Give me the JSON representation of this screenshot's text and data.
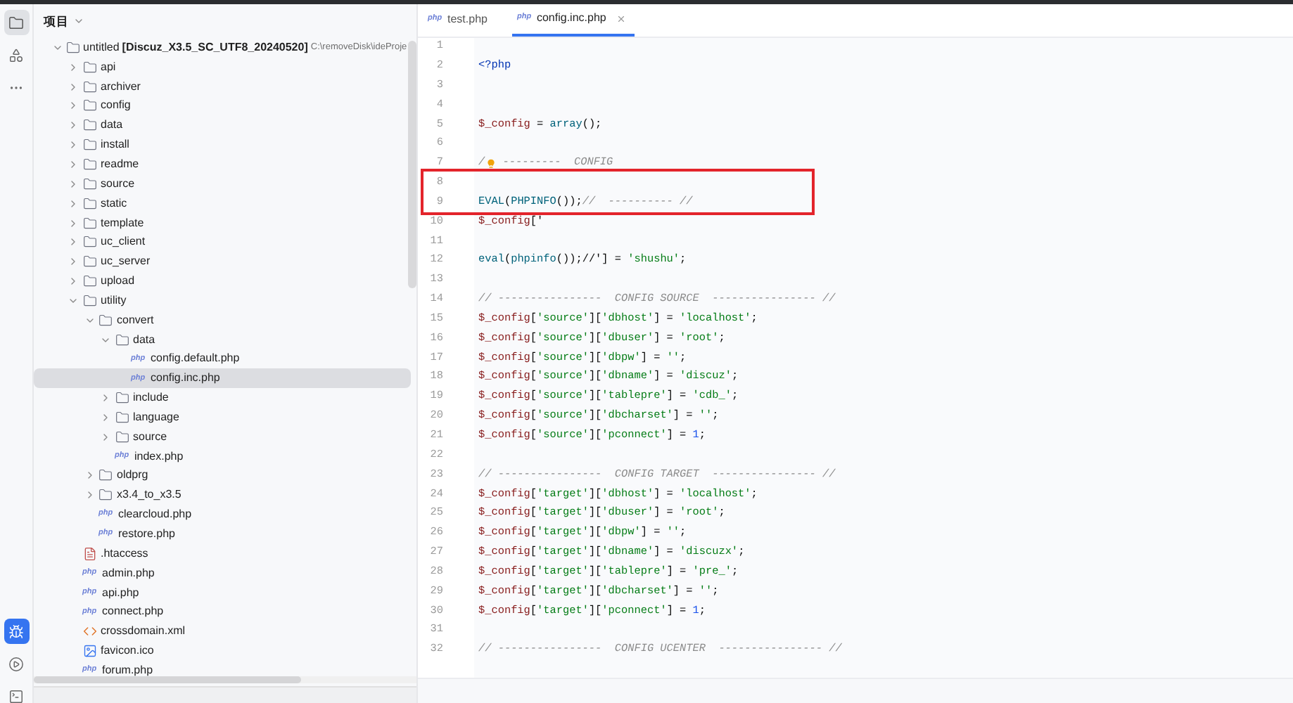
{
  "sidebar_strip": {
    "top": [
      {
        "kind": "folder",
        "selected": true
      },
      {
        "kind": "structure",
        "selected": false
      },
      {
        "kind": "more",
        "selected": false
      }
    ],
    "bottom": [
      {
        "kind": "bug",
        "selected": true
      },
      {
        "kind": "play",
        "selected": false
      },
      {
        "kind": "terminal",
        "selected": false
      }
    ]
  },
  "project": {
    "title": "项目",
    "root": {
      "name": "untitled",
      "module": "[Discuz_X3.5_SC_UTF8_20240520]",
      "path": "C:\\removeDisk\\ideProje",
      "expanded": true
    },
    "items": [
      {
        "label": "api",
        "kind": "folder",
        "expanded": false,
        "selected": false
      },
      {
        "label": "archiver",
        "kind": "folder",
        "expanded": false,
        "selected": false
      },
      {
        "label": "config",
        "kind": "folder",
        "expanded": false,
        "selected": false
      },
      {
        "label": "data",
        "kind": "folder",
        "expanded": false,
        "selected": false
      },
      {
        "label": "install",
        "kind": "folder",
        "expanded": false,
        "selected": false
      },
      {
        "label": "readme",
        "kind": "folder",
        "expanded": false,
        "selected": false
      },
      {
        "label": "source",
        "kind": "folder",
        "expanded": false,
        "selected": false
      },
      {
        "label": "static",
        "kind": "folder",
        "expanded": false,
        "selected": false
      },
      {
        "label": "template",
        "kind": "folder",
        "expanded": false,
        "selected": false
      },
      {
        "label": "uc_client",
        "kind": "folder",
        "expanded": false,
        "selected": false
      },
      {
        "label": "uc_server",
        "kind": "folder",
        "expanded": false,
        "selected": false
      },
      {
        "label": "upload",
        "kind": "folder",
        "expanded": false,
        "selected": false
      },
      {
        "label": "utility",
        "kind": "folder",
        "expanded": true,
        "selected": false,
        "children": [
          {
            "label": "convert",
            "kind": "folder",
            "expanded": true,
            "selected": false,
            "children": [
              {
                "label": "data",
                "kind": "folder",
                "expanded": true,
                "selected": false,
                "children": [
                  {
                    "label": "config.default.php",
                    "kind": "php",
                    "icon_text": "php",
                    "selected": false
                  },
                  {
                    "label": "config.inc.php",
                    "kind": "php",
                    "icon_text": "php",
                    "selected": true
                  }
                ]
              },
              {
                "label": "include",
                "kind": "folder",
                "expanded": false,
                "selected": false
              },
              {
                "label": "language",
                "kind": "folder",
                "expanded": false,
                "selected": false
              },
              {
                "label": "source",
                "kind": "folder",
                "expanded": false,
                "selected": false
              },
              {
                "label": "index.php",
                "kind": "php",
                "icon_text": "php",
                "selected": false
              }
            ]
          },
          {
            "label": "oldprg",
            "kind": "folder",
            "expanded": false,
            "selected": false
          },
          {
            "label": "x3.4_to_x3.5",
            "kind": "folder",
            "expanded": false,
            "selected": false
          },
          {
            "label": "clearcloud.php",
            "kind": "php",
            "icon_text": "php",
            "selected": false
          },
          {
            "label": "restore.php",
            "kind": "php",
            "icon_text": "php",
            "selected": false
          }
        ]
      },
      {
        "label": ".htaccess",
        "kind": "text",
        "selected": false
      },
      {
        "label": "admin.php",
        "kind": "php",
        "icon_text": "php",
        "selected": false
      },
      {
        "label": "api.php",
        "kind": "php",
        "icon_text": "php",
        "selected": false
      },
      {
        "label": "connect.php",
        "kind": "php",
        "icon_text": "php",
        "selected": false
      },
      {
        "label": "crossdomain.xml",
        "kind": "xml",
        "selected": false
      },
      {
        "label": "favicon.ico",
        "kind": "image",
        "selected": false
      },
      {
        "label": "forum.php",
        "kind": "php",
        "icon_text": "php",
        "selected": false
      }
    ]
  },
  "editor": {
    "tabs": [
      {
        "label": "test.php",
        "icon_text": "php",
        "selected": false,
        "closable": false
      },
      {
        "label": "config.inc.php",
        "icon_text": "php",
        "selected": true,
        "closable": true
      }
    ],
    "lines": [
      {
        "number": "1"
      },
      {
        "number": "2",
        "tokens": [
          {
            "kind": "kw",
            "text": "<?php"
          }
        ]
      },
      {
        "number": "3"
      },
      {
        "number": "4"
      },
      {
        "number": "5",
        "tokens": [
          {
            "kind": "var",
            "text": "$_config"
          },
          {
            "kind": "plain",
            "text": " = "
          },
          {
            "kind": "fn",
            "text": "array"
          },
          {
            "kind": "plain",
            "text": "();"
          }
        ]
      },
      {
        "number": "6"
      },
      {
        "number": "7",
        "tokens": [
          {
            "kind": "comment",
            "text": "/"
          },
          {
            "kind": "bulb"
          },
          {
            "kind": "comment",
            "text": " ---------  CONFIG"
          }
        ]
      },
      {
        "number": "8",
        "boxed": true
      },
      {
        "number": "9",
        "boxed": true,
        "tokens": [
          {
            "kind": "fn",
            "text": "EVAL"
          },
          {
            "kind": "plain",
            "text": "("
          },
          {
            "kind": "fn",
            "text": "PHPINFO"
          },
          {
            "kind": "plain",
            "text": "());"
          },
          {
            "kind": "comment",
            "text": "//  ---------- //"
          }
        ]
      },
      {
        "number": "10",
        "tokens": [
          {
            "kind": "var",
            "text": "$_config"
          },
          {
            "kind": "plain",
            "text": "['"
          }
        ]
      },
      {
        "number": "11"
      },
      {
        "number": "12",
        "tokens": [
          {
            "kind": "fn",
            "text": "eval"
          },
          {
            "kind": "plain",
            "text": "("
          },
          {
            "kind": "fn",
            "text": "phpinfo"
          },
          {
            "kind": "plain",
            "text": "());//'] = "
          },
          {
            "kind": "str",
            "text": "'shushu'"
          },
          {
            "kind": "plain",
            "text": ";"
          }
        ]
      },
      {
        "number": "13"
      },
      {
        "number": "14",
        "tokens": [
          {
            "kind": "comment",
            "text": "// ----------------  CONFIG SOURCE  ---------------- //"
          }
        ]
      },
      {
        "number": "15",
        "tokens": [
          {
            "kind": "var",
            "text": "$_config"
          },
          {
            "kind": "plain",
            "text": "["
          },
          {
            "kind": "str",
            "text": "'source'"
          },
          {
            "kind": "plain",
            "text": "]["
          },
          {
            "kind": "str",
            "text": "'dbhost'"
          },
          {
            "kind": "plain",
            "text": "] = "
          },
          {
            "kind": "str",
            "text": "'localhost'"
          },
          {
            "kind": "plain",
            "text": ";"
          }
        ]
      },
      {
        "number": "16",
        "tokens": [
          {
            "kind": "var",
            "text": "$_config"
          },
          {
            "kind": "plain",
            "text": "["
          },
          {
            "kind": "str",
            "text": "'source'"
          },
          {
            "kind": "plain",
            "text": "]["
          },
          {
            "kind": "str",
            "text": "'dbuser'"
          },
          {
            "kind": "plain",
            "text": "] = "
          },
          {
            "kind": "str",
            "text": "'root'"
          },
          {
            "kind": "plain",
            "text": ";"
          }
        ]
      },
      {
        "number": "17",
        "tokens": [
          {
            "kind": "var",
            "text": "$_config"
          },
          {
            "kind": "plain",
            "text": "["
          },
          {
            "kind": "str",
            "text": "'source'"
          },
          {
            "kind": "plain",
            "text": "]["
          },
          {
            "kind": "str",
            "text": "'dbpw'"
          },
          {
            "kind": "plain",
            "text": "] = "
          },
          {
            "kind": "str",
            "text": "''"
          },
          {
            "kind": "plain",
            "text": ";"
          }
        ]
      },
      {
        "number": "18",
        "tokens": [
          {
            "kind": "var",
            "text": "$_config"
          },
          {
            "kind": "plain",
            "text": "["
          },
          {
            "kind": "str",
            "text": "'source'"
          },
          {
            "kind": "plain",
            "text": "]["
          },
          {
            "kind": "str",
            "text": "'dbname'"
          },
          {
            "kind": "plain",
            "text": "] = "
          },
          {
            "kind": "str",
            "text": "'discuz'"
          },
          {
            "kind": "plain",
            "text": ";"
          }
        ]
      },
      {
        "number": "19",
        "tokens": [
          {
            "kind": "var",
            "text": "$_config"
          },
          {
            "kind": "plain",
            "text": "["
          },
          {
            "kind": "str",
            "text": "'source'"
          },
          {
            "kind": "plain",
            "text": "]["
          },
          {
            "kind": "str",
            "text": "'tablepre'"
          },
          {
            "kind": "plain",
            "text": "] = "
          },
          {
            "kind": "str",
            "text": "'cdb_'"
          },
          {
            "kind": "plain",
            "text": ";"
          }
        ]
      },
      {
        "number": "20",
        "tokens": [
          {
            "kind": "var",
            "text": "$_config"
          },
          {
            "kind": "plain",
            "text": "["
          },
          {
            "kind": "str",
            "text": "'source'"
          },
          {
            "kind": "plain",
            "text": "]["
          },
          {
            "kind": "str",
            "text": "'dbcharset'"
          },
          {
            "kind": "plain",
            "text": "] = "
          },
          {
            "kind": "str",
            "text": "''"
          },
          {
            "kind": "plain",
            "text": ";"
          }
        ]
      },
      {
        "number": "21",
        "tokens": [
          {
            "kind": "var",
            "text": "$_config"
          },
          {
            "kind": "plain",
            "text": "["
          },
          {
            "kind": "str",
            "text": "'source'"
          },
          {
            "kind": "plain",
            "text": "]["
          },
          {
            "kind": "str",
            "text": "'pconnect'"
          },
          {
            "kind": "plain",
            "text": "] = "
          },
          {
            "kind": "num",
            "text": "1"
          },
          {
            "kind": "plain",
            "text": ";"
          }
        ]
      },
      {
        "number": "22"
      },
      {
        "number": "23",
        "tokens": [
          {
            "kind": "comment",
            "text": "// ----------------  CONFIG TARGET  ---------------- //"
          }
        ]
      },
      {
        "number": "24",
        "tokens": [
          {
            "kind": "var",
            "text": "$_config"
          },
          {
            "kind": "plain",
            "text": "["
          },
          {
            "kind": "str",
            "text": "'target'"
          },
          {
            "kind": "plain",
            "text": "]["
          },
          {
            "kind": "str",
            "text": "'dbhost'"
          },
          {
            "kind": "plain",
            "text": "] = "
          },
          {
            "kind": "str",
            "text": "'localhost'"
          },
          {
            "kind": "plain",
            "text": ";"
          }
        ]
      },
      {
        "number": "25",
        "tokens": [
          {
            "kind": "var",
            "text": "$_config"
          },
          {
            "kind": "plain",
            "text": "["
          },
          {
            "kind": "str",
            "text": "'target'"
          },
          {
            "kind": "plain",
            "text": "]["
          },
          {
            "kind": "str",
            "text": "'dbuser'"
          },
          {
            "kind": "plain",
            "text": "] = "
          },
          {
            "kind": "str",
            "text": "'root'"
          },
          {
            "kind": "plain",
            "text": ";"
          }
        ]
      },
      {
        "number": "26",
        "tokens": [
          {
            "kind": "var",
            "text": "$_config"
          },
          {
            "kind": "plain",
            "text": "["
          },
          {
            "kind": "str",
            "text": "'target'"
          },
          {
            "kind": "plain",
            "text": "]["
          },
          {
            "kind": "str",
            "text": "'dbpw'"
          },
          {
            "kind": "plain",
            "text": "] = "
          },
          {
            "kind": "str",
            "text": "''"
          },
          {
            "kind": "plain",
            "text": ";"
          }
        ]
      },
      {
        "number": "27",
        "tokens": [
          {
            "kind": "var",
            "text": "$_config"
          },
          {
            "kind": "plain",
            "text": "["
          },
          {
            "kind": "str",
            "text": "'target'"
          },
          {
            "kind": "plain",
            "text": "]["
          },
          {
            "kind": "str",
            "text": "'dbname'"
          },
          {
            "kind": "plain",
            "text": "] = "
          },
          {
            "kind": "str",
            "text": "'discuzx'"
          },
          {
            "kind": "plain",
            "text": ";"
          }
        ]
      },
      {
        "number": "28",
        "tokens": [
          {
            "kind": "var",
            "text": "$_config"
          },
          {
            "kind": "plain",
            "text": "["
          },
          {
            "kind": "str",
            "text": "'target'"
          },
          {
            "kind": "plain",
            "text": "]["
          },
          {
            "kind": "str",
            "text": "'tablepre'"
          },
          {
            "kind": "plain",
            "text": "] = "
          },
          {
            "kind": "str",
            "text": "'pre_'"
          },
          {
            "kind": "plain",
            "text": ";"
          }
        ]
      },
      {
        "number": "29",
        "tokens": [
          {
            "kind": "var",
            "text": "$_config"
          },
          {
            "kind": "plain",
            "text": "["
          },
          {
            "kind": "str",
            "text": "'target'"
          },
          {
            "kind": "plain",
            "text": "]["
          },
          {
            "kind": "str",
            "text": "'dbcharset'"
          },
          {
            "kind": "plain",
            "text": "] = "
          },
          {
            "kind": "str",
            "text": "''"
          },
          {
            "kind": "plain",
            "text": ";"
          }
        ]
      },
      {
        "number": "30",
        "tokens": [
          {
            "kind": "var",
            "text": "$_config"
          },
          {
            "kind": "plain",
            "text": "["
          },
          {
            "kind": "str",
            "text": "'target'"
          },
          {
            "kind": "plain",
            "text": "]["
          },
          {
            "kind": "str",
            "text": "'pconnect'"
          },
          {
            "kind": "plain",
            "text": "] = "
          },
          {
            "kind": "num",
            "text": "1"
          },
          {
            "kind": "plain",
            "text": ";"
          }
        ]
      },
      {
        "number": "31"
      },
      {
        "number": "32",
        "tokens": [
          {
            "kind": "comment",
            "text": "// ----------------  CONFIG UCENTER  ---------------- //"
          }
        ]
      }
    ]
  }
}
